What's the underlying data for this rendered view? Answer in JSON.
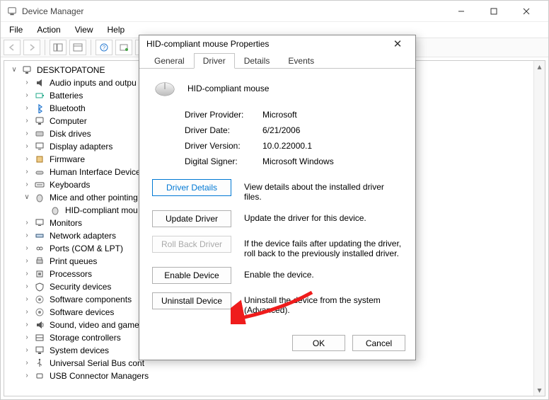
{
  "window": {
    "title": "Device Manager",
    "menu": {
      "file": "File",
      "action": "Action",
      "view": "View",
      "help": "Help"
    }
  },
  "tree": {
    "root": "DESKTOPATONE",
    "items": [
      {
        "label": "Audio inputs and outpu",
        "expanded": false
      },
      {
        "label": "Batteries",
        "expanded": false
      },
      {
        "label": "Bluetooth",
        "expanded": false
      },
      {
        "label": "Computer",
        "expanded": false
      },
      {
        "label": "Disk drives",
        "expanded": false
      },
      {
        "label": "Display adapters",
        "expanded": false
      },
      {
        "label": "Firmware",
        "expanded": false
      },
      {
        "label": "Human Interface Device",
        "expanded": false
      },
      {
        "label": "Keyboards",
        "expanded": false
      },
      {
        "label": "Mice and other pointing",
        "expanded": true,
        "children": [
          {
            "label": "HID-compliant mou"
          }
        ]
      },
      {
        "label": "Monitors",
        "expanded": false
      },
      {
        "label": "Network adapters",
        "expanded": false
      },
      {
        "label": "Ports (COM & LPT)",
        "expanded": false
      },
      {
        "label": "Print queues",
        "expanded": false
      },
      {
        "label": "Processors",
        "expanded": false
      },
      {
        "label": "Security devices",
        "expanded": false
      },
      {
        "label": "Software components",
        "expanded": false
      },
      {
        "label": "Software devices",
        "expanded": false
      },
      {
        "label": "Sound, video and game",
        "expanded": false
      },
      {
        "label": "Storage controllers",
        "expanded": false
      },
      {
        "label": "System devices",
        "expanded": false
      },
      {
        "label": "Universal Serial Bus cont",
        "expanded": false
      },
      {
        "label": "USB Connector Managers",
        "expanded": false
      }
    ]
  },
  "dialog": {
    "title": "HID-compliant mouse Properties",
    "device_name": "HID-compliant mouse",
    "tabs": {
      "general": "General",
      "driver": "Driver",
      "details": "Details",
      "events": "Events"
    },
    "info": {
      "provider_label": "Driver Provider:",
      "provider_value": "Microsoft",
      "date_label": "Driver Date:",
      "date_value": "6/21/2006",
      "version_label": "Driver Version:",
      "version_value": "10.0.22000.1",
      "signer_label": "Digital Signer:",
      "signer_value": "Microsoft Windows"
    },
    "actions": {
      "details_btn": "Driver Details",
      "details_desc": "View details about the installed driver files.",
      "update_btn": "Update Driver",
      "update_desc": "Update the driver for this device.",
      "rollback_btn": "Roll Back Driver",
      "rollback_desc": "If the device fails after updating the driver, roll back to the previously installed driver.",
      "enable_btn": "Enable Device",
      "enable_desc": "Enable the device.",
      "uninstall_btn": "Uninstall Device",
      "uninstall_desc": "Uninstall the device from the system (Advanced)."
    },
    "footer": {
      "ok": "OK",
      "cancel": "Cancel"
    }
  }
}
